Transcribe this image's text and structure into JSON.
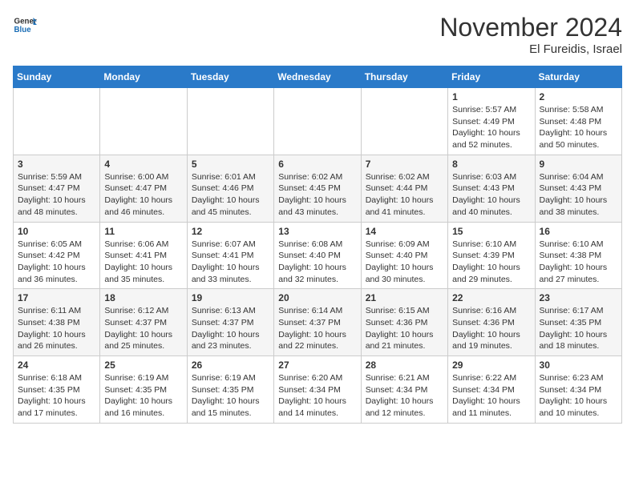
{
  "header": {
    "logo_general": "General",
    "logo_blue": "Blue",
    "month_year": "November 2024",
    "location": "El Fureidis, Israel"
  },
  "weekdays": [
    "Sunday",
    "Monday",
    "Tuesday",
    "Wednesday",
    "Thursday",
    "Friday",
    "Saturday"
  ],
  "weeks": [
    [
      {
        "day": "",
        "sunrise": "",
        "sunset": "",
        "daylight": ""
      },
      {
        "day": "",
        "sunrise": "",
        "sunset": "",
        "daylight": ""
      },
      {
        "day": "",
        "sunrise": "",
        "sunset": "",
        "daylight": ""
      },
      {
        "day": "",
        "sunrise": "",
        "sunset": "",
        "daylight": ""
      },
      {
        "day": "",
        "sunrise": "",
        "sunset": "",
        "daylight": ""
      },
      {
        "day": "1",
        "sunrise": "Sunrise: 5:57 AM",
        "sunset": "Sunset: 4:49 PM",
        "daylight": "Daylight: 10 hours and 52 minutes."
      },
      {
        "day": "2",
        "sunrise": "Sunrise: 5:58 AM",
        "sunset": "Sunset: 4:48 PM",
        "daylight": "Daylight: 10 hours and 50 minutes."
      }
    ],
    [
      {
        "day": "3",
        "sunrise": "Sunrise: 5:59 AM",
        "sunset": "Sunset: 4:47 PM",
        "daylight": "Daylight: 10 hours and 48 minutes."
      },
      {
        "day": "4",
        "sunrise": "Sunrise: 6:00 AM",
        "sunset": "Sunset: 4:47 PM",
        "daylight": "Daylight: 10 hours and 46 minutes."
      },
      {
        "day": "5",
        "sunrise": "Sunrise: 6:01 AM",
        "sunset": "Sunset: 4:46 PM",
        "daylight": "Daylight: 10 hours and 45 minutes."
      },
      {
        "day": "6",
        "sunrise": "Sunrise: 6:02 AM",
        "sunset": "Sunset: 4:45 PM",
        "daylight": "Daylight: 10 hours and 43 minutes."
      },
      {
        "day": "7",
        "sunrise": "Sunrise: 6:02 AM",
        "sunset": "Sunset: 4:44 PM",
        "daylight": "Daylight: 10 hours and 41 minutes."
      },
      {
        "day": "8",
        "sunrise": "Sunrise: 6:03 AM",
        "sunset": "Sunset: 4:43 PM",
        "daylight": "Daylight: 10 hours and 40 minutes."
      },
      {
        "day": "9",
        "sunrise": "Sunrise: 6:04 AM",
        "sunset": "Sunset: 4:43 PM",
        "daylight": "Daylight: 10 hours and 38 minutes."
      }
    ],
    [
      {
        "day": "10",
        "sunrise": "Sunrise: 6:05 AM",
        "sunset": "Sunset: 4:42 PM",
        "daylight": "Daylight: 10 hours and 36 minutes."
      },
      {
        "day": "11",
        "sunrise": "Sunrise: 6:06 AM",
        "sunset": "Sunset: 4:41 PM",
        "daylight": "Daylight: 10 hours and 35 minutes."
      },
      {
        "day": "12",
        "sunrise": "Sunrise: 6:07 AM",
        "sunset": "Sunset: 4:41 PM",
        "daylight": "Daylight: 10 hours and 33 minutes."
      },
      {
        "day": "13",
        "sunrise": "Sunrise: 6:08 AM",
        "sunset": "Sunset: 4:40 PM",
        "daylight": "Daylight: 10 hours and 32 minutes."
      },
      {
        "day": "14",
        "sunrise": "Sunrise: 6:09 AM",
        "sunset": "Sunset: 4:40 PM",
        "daylight": "Daylight: 10 hours and 30 minutes."
      },
      {
        "day": "15",
        "sunrise": "Sunrise: 6:10 AM",
        "sunset": "Sunset: 4:39 PM",
        "daylight": "Daylight: 10 hours and 29 minutes."
      },
      {
        "day": "16",
        "sunrise": "Sunrise: 6:10 AM",
        "sunset": "Sunset: 4:38 PM",
        "daylight": "Daylight: 10 hours and 27 minutes."
      }
    ],
    [
      {
        "day": "17",
        "sunrise": "Sunrise: 6:11 AM",
        "sunset": "Sunset: 4:38 PM",
        "daylight": "Daylight: 10 hours and 26 minutes."
      },
      {
        "day": "18",
        "sunrise": "Sunrise: 6:12 AM",
        "sunset": "Sunset: 4:37 PM",
        "daylight": "Daylight: 10 hours and 25 minutes."
      },
      {
        "day": "19",
        "sunrise": "Sunrise: 6:13 AM",
        "sunset": "Sunset: 4:37 PM",
        "daylight": "Daylight: 10 hours and 23 minutes."
      },
      {
        "day": "20",
        "sunrise": "Sunrise: 6:14 AM",
        "sunset": "Sunset: 4:37 PM",
        "daylight": "Daylight: 10 hours and 22 minutes."
      },
      {
        "day": "21",
        "sunrise": "Sunrise: 6:15 AM",
        "sunset": "Sunset: 4:36 PM",
        "daylight": "Daylight: 10 hours and 21 minutes."
      },
      {
        "day": "22",
        "sunrise": "Sunrise: 6:16 AM",
        "sunset": "Sunset: 4:36 PM",
        "daylight": "Daylight: 10 hours and 19 minutes."
      },
      {
        "day": "23",
        "sunrise": "Sunrise: 6:17 AM",
        "sunset": "Sunset: 4:35 PM",
        "daylight": "Daylight: 10 hours and 18 minutes."
      }
    ],
    [
      {
        "day": "24",
        "sunrise": "Sunrise: 6:18 AM",
        "sunset": "Sunset: 4:35 PM",
        "daylight": "Daylight: 10 hours and 17 minutes."
      },
      {
        "day": "25",
        "sunrise": "Sunrise: 6:19 AM",
        "sunset": "Sunset: 4:35 PM",
        "daylight": "Daylight: 10 hours and 16 minutes."
      },
      {
        "day": "26",
        "sunrise": "Sunrise: 6:19 AM",
        "sunset": "Sunset: 4:35 PM",
        "daylight": "Daylight: 10 hours and 15 minutes."
      },
      {
        "day": "27",
        "sunrise": "Sunrise: 6:20 AM",
        "sunset": "Sunset: 4:34 PM",
        "daylight": "Daylight: 10 hours and 14 minutes."
      },
      {
        "day": "28",
        "sunrise": "Sunrise: 6:21 AM",
        "sunset": "Sunset: 4:34 PM",
        "daylight": "Daylight: 10 hours and 12 minutes."
      },
      {
        "day": "29",
        "sunrise": "Sunrise: 6:22 AM",
        "sunset": "Sunset: 4:34 PM",
        "daylight": "Daylight: 10 hours and 11 minutes."
      },
      {
        "day": "30",
        "sunrise": "Sunrise: 6:23 AM",
        "sunset": "Sunset: 4:34 PM",
        "daylight": "Daylight: 10 hours and 10 minutes."
      }
    ]
  ]
}
